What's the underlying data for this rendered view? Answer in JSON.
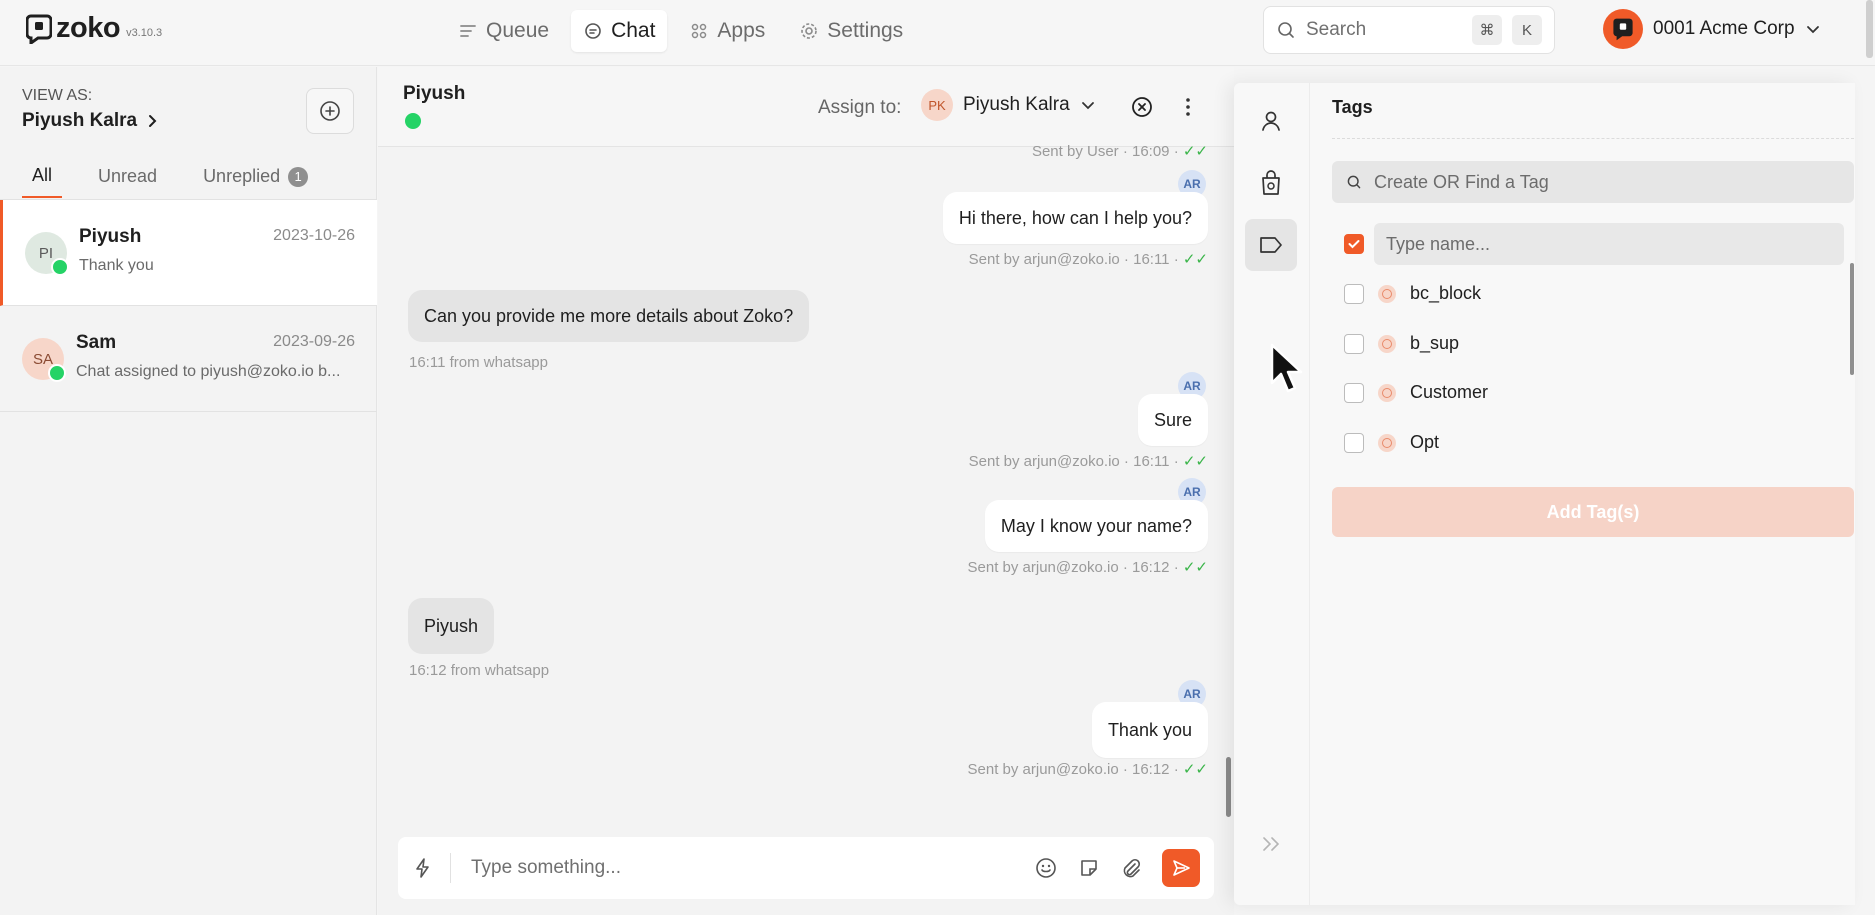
{
  "app": {
    "name": "zoko",
    "version": "v3.10.3"
  },
  "nav": [
    {
      "label": "Queue",
      "icon": "queue-icon"
    },
    {
      "label": "Chat",
      "icon": "chat-icon"
    },
    {
      "label": "Apps",
      "icon": "apps-icon"
    },
    {
      "label": "Settings",
      "icon": "gear-icon"
    }
  ],
  "search": {
    "placeholder": "Search",
    "shortcut_keys": [
      "⌘",
      "K"
    ]
  },
  "account": {
    "name": "0001 Acme Corp"
  },
  "sidebar": {
    "view_as_label": "VIEW AS:",
    "view_as_name": "Piyush Kalra",
    "tabs": [
      {
        "label": "All"
      },
      {
        "label": "Unread"
      },
      {
        "label": "Unreplied",
        "badge": "1"
      }
    ],
    "conversations": [
      {
        "initials": "PI",
        "name": "Piyush",
        "date": "2023-10-26",
        "preview": "Thank you",
        "avatar_color": "#dfe9e1"
      },
      {
        "initials": "SA",
        "name": "Sam",
        "date": "2023-09-26",
        "preview": "Chat assigned to piyush@zoko.io b...",
        "avatar_color": "#f7d6c9"
      }
    ]
  },
  "chat": {
    "contact_name": "Piyush",
    "assign_label": "Assign to:",
    "assignee_initials": "PK",
    "assignee_name": "Piyush Kalra",
    "top_meta": "Sent by User · 16:09 · ",
    "messages": [
      {
        "dir": "out",
        "avatar": "AR",
        "text": "Hi there, how can I help you?",
        "meta": "Sent by arjun@zoko.io · 16:11 · "
      },
      {
        "dir": "in",
        "text": "Can you provide me more details about Zoko?",
        "meta": "16:11 from whatsapp"
      },
      {
        "dir": "out",
        "avatar": "AR",
        "text": "Sure",
        "meta": "Sent by arjun@zoko.io · 16:11 · "
      },
      {
        "dir": "out",
        "avatar": "AR",
        "text": "May I know your name?",
        "meta": "Sent by arjun@zoko.io · 16:12 · "
      },
      {
        "dir": "in",
        "text": "Piyush",
        "meta": "16:12 from whatsapp"
      },
      {
        "dir": "out",
        "avatar": "AR",
        "text": "Thank you",
        "meta": "Sent by arjun@zoko.io · 16:12 · "
      }
    ],
    "composer_placeholder": "Type something..."
  },
  "tags_panel": {
    "title": "Tags",
    "search_placeholder": "Create OR Find a Tag",
    "new_tag_placeholder": "Type name...",
    "tags": [
      {
        "label": "bc_block",
        "checked": false
      },
      {
        "label": "b_sup",
        "checked": false
      },
      {
        "label": "Customer",
        "checked": false
      },
      {
        "label": "Opt",
        "checked": false
      }
    ],
    "add_button": "Add Tag(s)"
  },
  "colors": {
    "accent": "#f05a28",
    "whatsapp": "#25d366",
    "tick": "#3bb54a"
  }
}
